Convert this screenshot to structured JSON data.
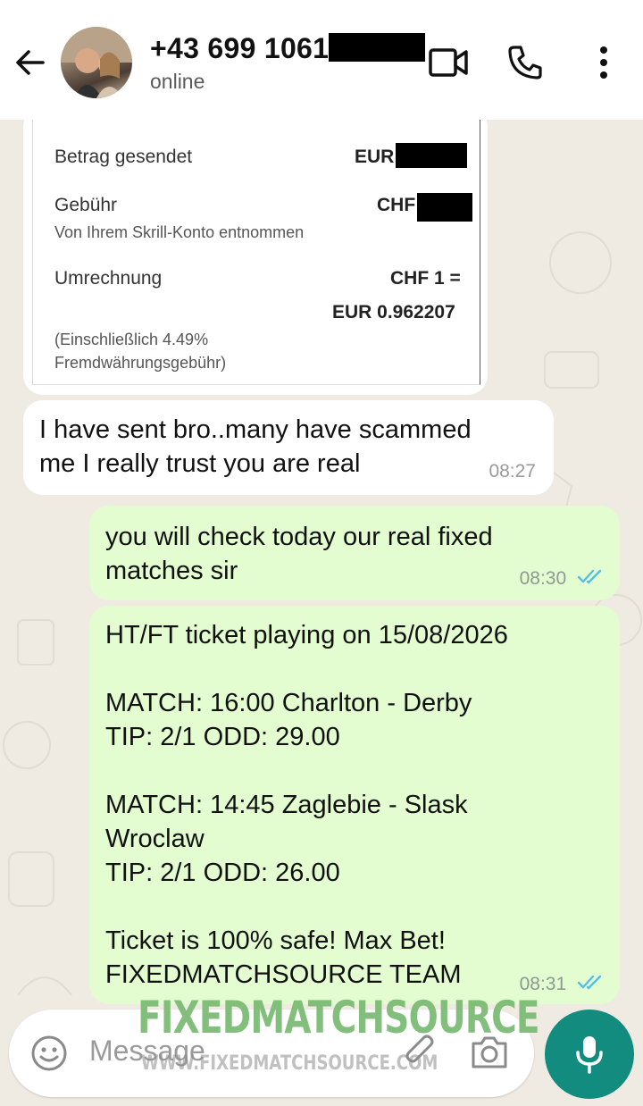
{
  "header": {
    "contact_name": "+43 699 1061",
    "status": "online"
  },
  "receipt": {
    "sent_label": "Betrag gesendet",
    "sent_currency": "EUR",
    "fee_label": "Gebühr",
    "fee_currency": "CHF",
    "fee_note": "Von Ihrem Skrill-Konto entnommen",
    "conversion_label": "Umrechnung",
    "conversion_line1": "CHF 1 =",
    "conversion_line2": "EUR 0.962207",
    "footnote_line1": "(Einschließlich 4.49%",
    "footnote_line2": "Fremdwährungsgebühr)"
  },
  "messages": [
    {
      "direction": "incoming",
      "text": "I have sent bro..many have scammed\nme I really trust you are real",
      "time": "08:27"
    },
    {
      "direction": "outgoing",
      "text": "you will check today our real fixed\nmatches sir",
      "time": "08:30",
      "read": true
    },
    {
      "direction": "outgoing",
      "text": "HT/FT ticket playing on 15/08/2026\n\nMATCH: 16:00 Charlton - Derby\nTIP: 2/1 ODD: 29.00\n\nMATCH: 14:45 Zaglebie - Slask\nWroclaw\nTIP: 2/1 ODD: 26.00\n\nTicket is 100% safe! Max Bet!\nFIXEDMATCHSOURCE TEAM",
      "time": "08:31",
      "read": true
    }
  ],
  "composer": {
    "placeholder": "Message"
  },
  "watermark": {
    "title": "FIXEDMATCHSOURCE",
    "url": "WWW.FIXEDMATCHSOURCE.COM"
  },
  "colors": {
    "outgoing_bubble": "#e3fdd0",
    "incoming_bubble": "#ffffff",
    "read_ticks": "#53bdeb",
    "mic_button": "#128c7e",
    "wallpaper": "#efeae2"
  },
  "icons": [
    "back-arrow-icon",
    "video-call-icon",
    "phone-icon",
    "more-vert-icon",
    "emoji-icon",
    "attach-icon",
    "camera-icon",
    "mic-icon",
    "double-check-icon"
  ]
}
